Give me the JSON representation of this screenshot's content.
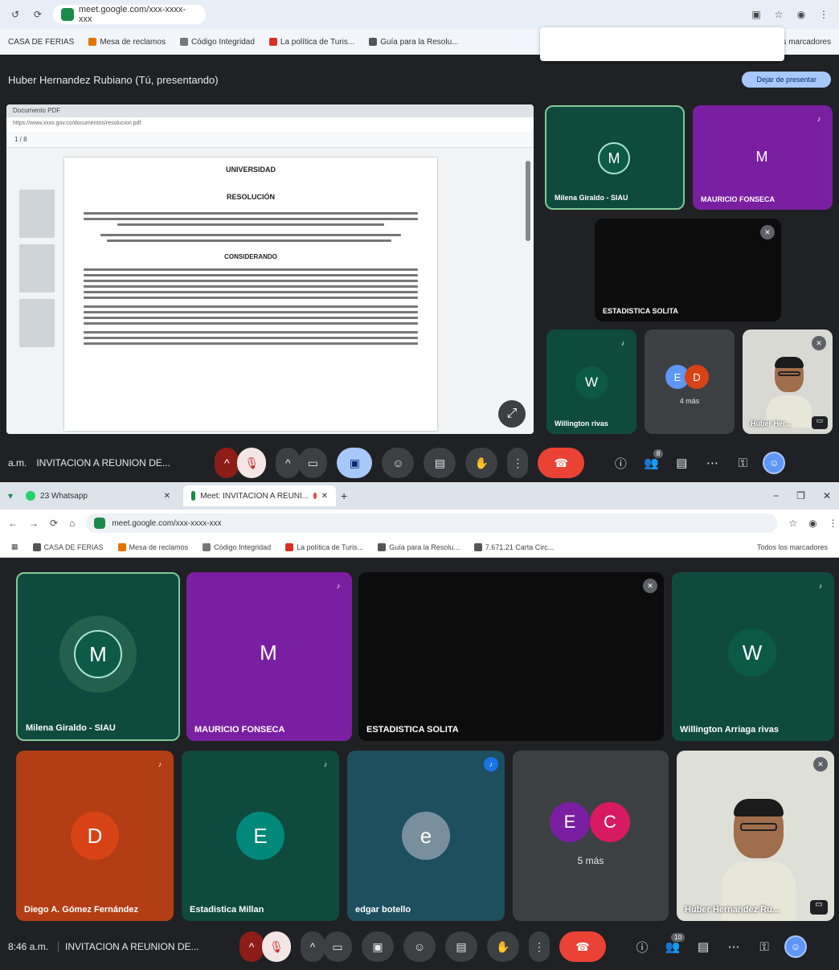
{
  "top": {
    "chrome": {
      "url": "meet.google.com/xxx-xxxx-xxx",
      "bookmarks": [
        "CASA DE FERIAS",
        "Mesa de reclamos",
        "Código Integridad",
        "La política de Turis...",
        "Guía para la Resolu...",
        "Otros marcadores"
      ]
    },
    "presenting_text": "Huber Hernandez Rubiano (Tú, presentando)",
    "stop_presenting": "Dejar de presentar",
    "doc": {
      "tab": "Documento PDF",
      "url": "https://www.xxxx.gov.co/documentos/resolucion.pdf",
      "toolbar": "1 / 8",
      "heading": "UNIVERSIDAD",
      "subheading": "RESOLUCIÓN",
      "section": "CONSIDERANDO"
    },
    "tiles": {
      "milena": {
        "name": "Milena Giraldo - SIAU",
        "initial": "M"
      },
      "mauricio": {
        "name": "MAURICIO FONSECA",
        "initial": "M"
      },
      "estadistica": {
        "name": "ESTADISTICA SOLITA"
      },
      "willington": {
        "name": "Willington rivas",
        "initial": "W"
      },
      "others": {
        "initial1": "E",
        "initial2": "D",
        "label": "4 más"
      },
      "self": {
        "name": "Huber Her..."
      }
    },
    "controls": {
      "time": "a.m.",
      "meeting": "INVITACION A REUNION DE..."
    }
  },
  "bottom": {
    "tabs": [
      "23 Whatsapp",
      "Meet: INVITACION A REUNI..."
    ],
    "url": "meet.google.com/xxx-xxxx-xxx",
    "bookmarks": [
      "CASA DE FERIAS",
      "Mesa de reclamos",
      "Código Integridad",
      "La política de Turis...",
      "Guía para la Resolu...",
      "7.671.21 Carta Circ...",
      "Todos los marcadores"
    ],
    "tiles": {
      "milena": {
        "name": "Milena Giraldo - SIAU",
        "initial": "M"
      },
      "mauricio": {
        "name": "MAURICIO FONSECA",
        "initial": "M"
      },
      "estadistica": {
        "name": "ESTADISTICA SOLITA"
      },
      "willington": {
        "name": "Willington Arriaga rivas",
        "initial": "W"
      },
      "diego": {
        "name": "Diego A. Gómez Fernández",
        "initial": "D"
      },
      "estmillan": {
        "name": "Estadistica Millan",
        "initial": "E"
      },
      "edgar": {
        "name": "edgar botello",
        "initial": "e"
      },
      "others": {
        "initial1": "E",
        "initial2": "C",
        "label": "5 más"
      },
      "self": {
        "name": "Huber Hernandez Ru..."
      }
    },
    "controls": {
      "time": "8:46 a.m.",
      "meeting": "INVITACION A REUNION DE..."
    }
  },
  "colors": {
    "meet_bg": "#202124",
    "teal_tile": "#0f4a3f",
    "purple_tile": "#7b1fa2",
    "orange_tile": "#b33d14",
    "end_call": "#ea4335"
  }
}
